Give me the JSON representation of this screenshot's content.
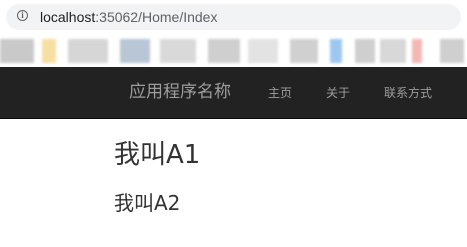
{
  "browser": {
    "url_host": "localhost",
    "url_path": ":35062/Home/Index",
    "info_icon": "info-icon"
  },
  "bookmarks": {
    "blur_colors": [
      "#c9c9c9",
      "#f6dfa3",
      "#d6d6d6",
      "#b9c6d6",
      "#d9d9d9",
      "#cfcfcf",
      "#e3e3e3",
      "#d0d0d0",
      "#9cc8f0",
      "#cfcfcf",
      "#d8d8d8",
      "#f3b7b7",
      "#cfcfcf"
    ]
  },
  "navbar": {
    "brand": "应用程序名称",
    "links": [
      {
        "label": "主页"
      },
      {
        "label": "关于"
      },
      {
        "label": "联系方式"
      }
    ],
    "background": "#222222",
    "text_color": "#9d9d9d"
  },
  "content": {
    "heading1": "我叫A1",
    "heading2": "我叫A2"
  }
}
